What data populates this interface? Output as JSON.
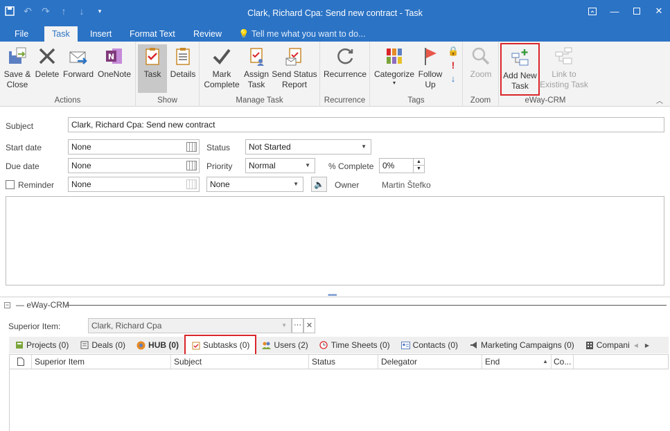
{
  "window": {
    "title": "Clark, Richard Cpa: Send new contract - Task"
  },
  "ribbon_tabs": [
    {
      "label": "File"
    },
    {
      "label": "Task"
    },
    {
      "label": "Insert"
    },
    {
      "label": "Format Text"
    },
    {
      "label": "Review"
    }
  ],
  "tell_me": "Tell me what you want to do...",
  "groups": {
    "actions": {
      "label": "Actions",
      "save_close": "Save &\nClose",
      "delete": "Delete",
      "forward": "Forward",
      "onenote": "OneNote"
    },
    "show": {
      "label": "Show",
      "task": "Task",
      "details": "Details"
    },
    "manage": {
      "label": "Manage Task",
      "mark_complete": "Mark\nComplete",
      "assign_task": "Assign\nTask",
      "send_status": "Send Status\nReport"
    },
    "recurrence": {
      "label": "Recurrence",
      "recurrence": "Recurrence"
    },
    "tags": {
      "label": "Tags",
      "categorize": "Categorize",
      "follow_up": "Follow\nUp"
    },
    "zoom": {
      "label": "Zoom",
      "zoom": "Zoom"
    },
    "eway": {
      "label": "eWay-CRM",
      "add_new_task": "Add New\nTask",
      "link_existing": "Link to\nExisting Task"
    }
  },
  "form": {
    "subject_label": "Subject",
    "subject_value": "Clark, Richard Cpa: Send new contract",
    "start_label": "Start date",
    "start_value": "None",
    "due_label": "Due date",
    "due_value": "None",
    "reminder_label": "Reminder",
    "reminder_date": "None",
    "reminder_time": "None",
    "status_label": "Status",
    "status_value": "Not Started",
    "priority_label": "Priority",
    "priority_value": "Normal",
    "complete_label": "% Complete",
    "complete_value": "0%",
    "owner_label": "Owner",
    "owner_value": "Martin Štefko"
  },
  "crm": {
    "header": "eWay-CRM",
    "superior_label": "Superior Item:",
    "superior_value": "Clark, Richard Cpa",
    "tabs": [
      {
        "label": "Projects (0)"
      },
      {
        "label": "Deals (0)"
      },
      {
        "label": "HUB (0)"
      },
      {
        "label": "Subtasks (0)"
      },
      {
        "label": "Users (2)"
      },
      {
        "label": "Time Sheets (0)"
      },
      {
        "label": "Contacts (0)"
      },
      {
        "label": "Marketing Campaigns (0)"
      },
      {
        "label": "Companies"
      }
    ],
    "columns": [
      {
        "label": "Superior Item"
      },
      {
        "label": "Subject"
      },
      {
        "label": "Status"
      },
      {
        "label": "Delegator"
      },
      {
        "label": "End"
      },
      {
        "label": "Co..."
      }
    ]
  }
}
